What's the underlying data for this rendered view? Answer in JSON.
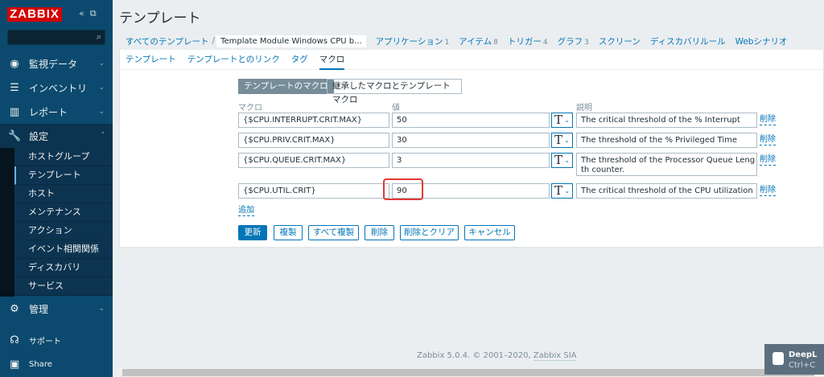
{
  "sidebar": {
    "logo": "ZABBIX",
    "menu": [
      {
        "label": "監視データ",
        "icon": "eye-icon"
      },
      {
        "label": "インベントリ",
        "icon": "list-icon"
      },
      {
        "label": "レポート",
        "icon": "bar-chart-icon"
      },
      {
        "label": "設定",
        "icon": "wrench-icon"
      },
      {
        "label": "管理",
        "icon": "gear-icon"
      }
    ],
    "submenu": [
      "ホストグループ",
      "テンプレート",
      "ホスト",
      "メンテナンス",
      "アクション",
      "イベント相関関係",
      "ディスカバリ",
      "サービス"
    ],
    "support": "サポート",
    "share": "Share"
  },
  "page_title": "テンプレート",
  "breadcrumb": {
    "all": "すべてのテンプレート",
    "sep": "/",
    "current": "Template Module Windows CPU b..."
  },
  "top_tabs": [
    {
      "label": "アプリケーション",
      "count": "1"
    },
    {
      "label": "アイテム",
      "count": "8"
    },
    {
      "label": "トリガー",
      "count": "4"
    },
    {
      "label": "グラフ",
      "count": "3"
    },
    {
      "label": "スクリーン",
      "count": ""
    },
    {
      "label": "ディスカバリルール",
      "count": ""
    },
    {
      "label": "Webシナリオ",
      "count": ""
    }
  ],
  "form_tabs": [
    "テンプレート",
    "テンプレートとのリンク",
    "タグ",
    "マクロ"
  ],
  "segment": {
    "own": "テンプレートのマクロ",
    "inherited": "継承したマクロとテンプレートマクロ"
  },
  "headers": {
    "macro": "マクロ",
    "value": "値",
    "description": "説明"
  },
  "macros": [
    {
      "macro": "{$CPU.INTERRUPT.CRIT.MAX}",
      "value": "50",
      "type": "T",
      "description": "The critical threshold of the % Interrupt Time counter.",
      "remove": "削除"
    },
    {
      "macro": "{$CPU.PRIV.CRIT.MAX}",
      "value": "30",
      "type": "T",
      "description": "The threshold of the % Privileged Time counter.",
      "remove": "削除"
    },
    {
      "macro": "{$CPU.QUEUE.CRIT.MAX}",
      "value": "3",
      "type": "T",
      "description": "The threshold of the Processor Queue Length counter.",
      "remove": "削除"
    },
    {
      "macro": "{$CPU.UTIL.CRIT}",
      "value": "90",
      "type": "T",
      "description": "The critical threshold of the CPU utilization in %.",
      "remove": "削除"
    }
  ],
  "add": "追加",
  "buttons": {
    "update": "更新",
    "clone": "複製",
    "full_clone": "すべて複製",
    "delete": "削除",
    "delete_clear": "削除とクリア",
    "cancel": "キャンセル"
  },
  "footer": {
    "text": "Zabbix 5.0.4. © 2001–2020, ",
    "link": "Zabbix SIA"
  },
  "deepl": {
    "name": "DeepL",
    "shortcut": "Ctrl+C"
  }
}
